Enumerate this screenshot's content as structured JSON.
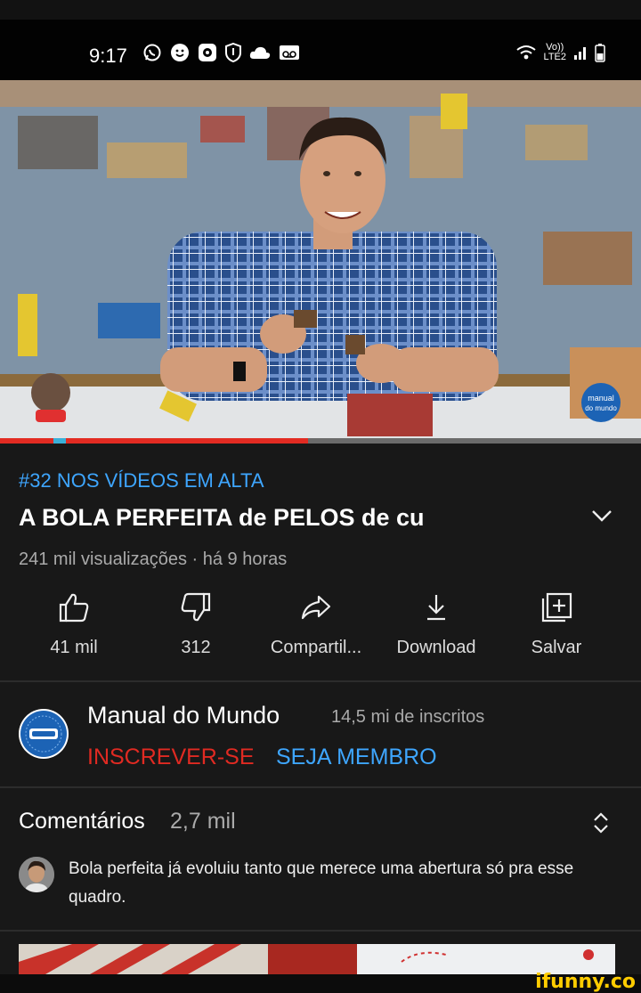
{
  "status_bar": {
    "time": "9:17",
    "network_label_top": "Vo))",
    "network_label_bottom": "LTE2"
  },
  "video": {
    "progress_fraction": 0.48,
    "channel_watermark_line1": "manual",
    "channel_watermark_line2": "do mundo"
  },
  "details": {
    "trending": "#32 NOS VÍDEOS EM ALTA",
    "title": "A BOLA PERFEITA de PELOS de cu",
    "meta": "241 mil visualizações · há 9 horas"
  },
  "actions": {
    "like": "41 mil",
    "dislike": "312",
    "share": "Compartil...",
    "download": "Download",
    "save": "Salvar"
  },
  "channel": {
    "name": "Manual do Mundo",
    "subscribers": "14,5 mi de inscritos",
    "subscribe": "INSCREVER-SE",
    "member": "SEJA MEMBRO"
  },
  "comments": {
    "title": "Comentários",
    "count": "2,7 mil",
    "top_comment": "Bola perfeita já evoluiu tanto que merece uma abertura só pra esse quadro."
  },
  "watermark": "ifunny.co",
  "colors": {
    "accent_blue": "#3ea6ff",
    "subscribe_red": "#e02a22",
    "progress_red": "#e22b22",
    "background": "#181818"
  },
  "icons": [
    "whatsapp-icon",
    "emoji-icon",
    "app-icon",
    "shield-icon",
    "cloud-icon",
    "voicemail-icon",
    "wifi-icon",
    "signal-icon",
    "battery-icon",
    "chevron-down-icon",
    "like-icon",
    "dislike-icon",
    "share-icon",
    "download-icon",
    "save-playlist-icon",
    "expand-collapse-icon"
  ]
}
